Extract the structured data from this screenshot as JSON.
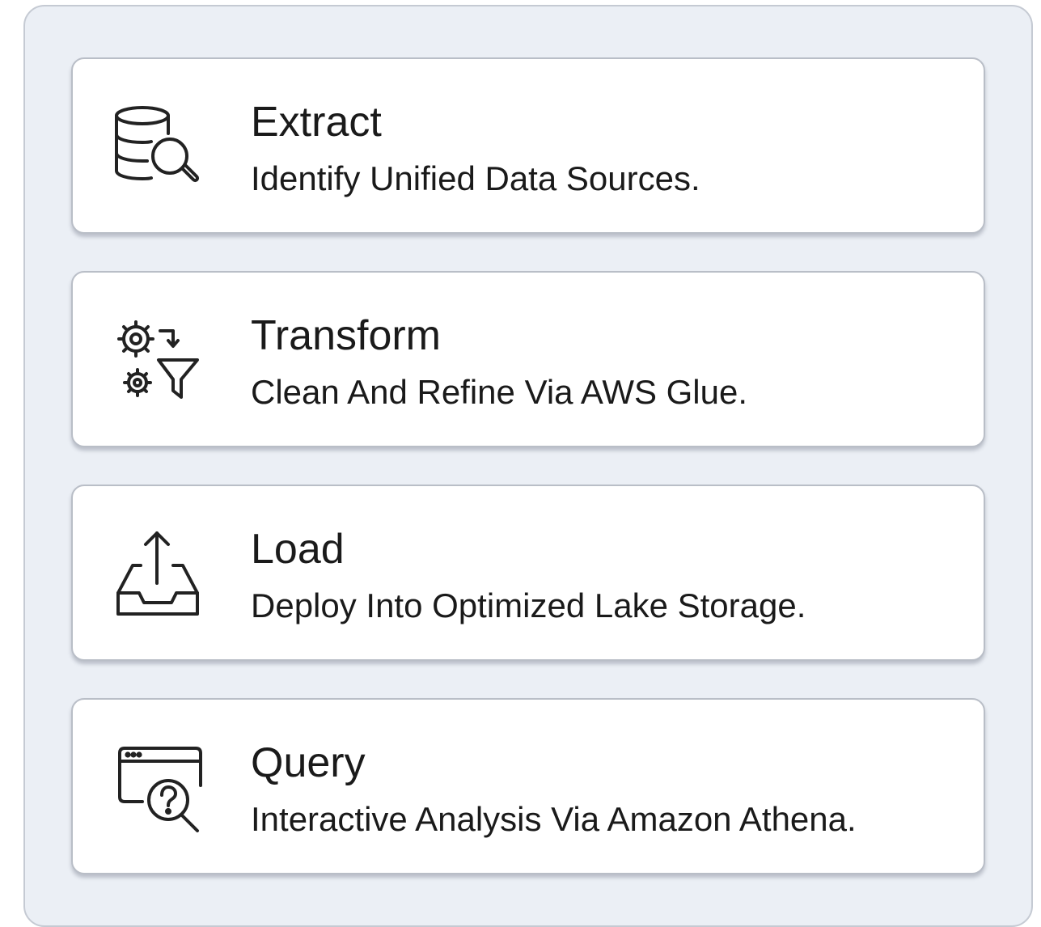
{
  "steps": [
    {
      "title": "Extract",
      "description": "Identify Unified Data Sources.",
      "icon": "database-search-icon"
    },
    {
      "title": "Transform",
      "description": "Clean And Refine Via AWS Glue.",
      "icon": "gears-filter-icon"
    },
    {
      "title": "Load",
      "description": "Deploy Into Optimized Lake Storage.",
      "icon": "tray-upload-icon"
    },
    {
      "title": "Query",
      "description": "Interactive Analysis Via Amazon Athena.",
      "icon": "window-query-icon"
    }
  ],
  "colors": {
    "panel_background": "#ebeff5",
    "panel_border": "#c5cad3",
    "card_background": "#ffffff",
    "card_border": "#b9bec7",
    "text": "#1a1a1a",
    "icon_stroke": "#222222"
  }
}
